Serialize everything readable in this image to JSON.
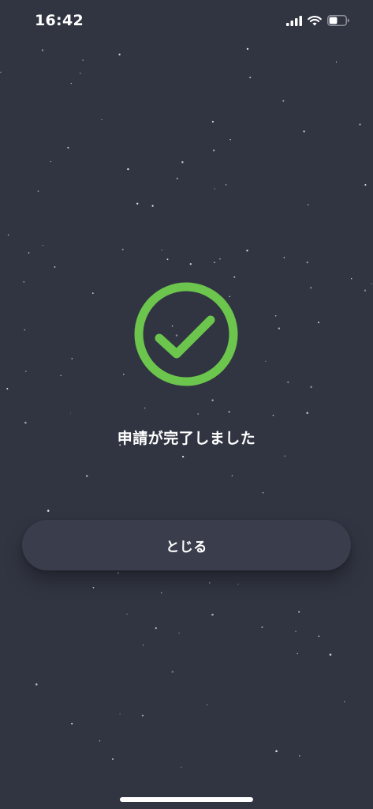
{
  "status_bar": {
    "time": "16:42",
    "signal_icon": "cellular-signal-icon",
    "wifi_icon": "wifi-icon",
    "battery_icon": "battery-icon",
    "battery_level": 0.5
  },
  "success_icon": {
    "icon": "check-circle-icon",
    "color": "#6cc54c"
  },
  "message": "申請が完了しました",
  "close_button": {
    "label": "とじる"
  },
  "colors": {
    "background": "#313542",
    "button_background": "#3a3e4c",
    "text": "#ffffff",
    "accent": "#6cc54c"
  }
}
